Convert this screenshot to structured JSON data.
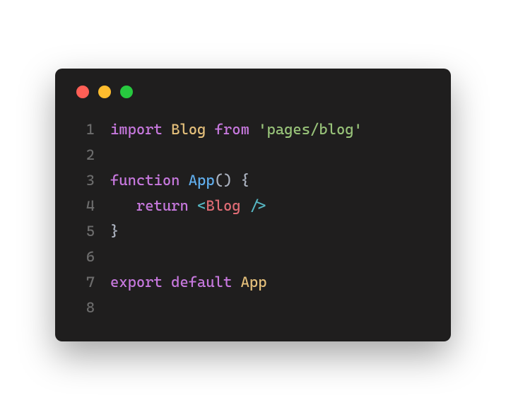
{
  "window": {
    "traffic_lights": [
      "red",
      "yellow",
      "green"
    ]
  },
  "code": {
    "lines": [
      {
        "num": "1",
        "tokens": [
          {
            "t": "import",
            "c": "tok-keyword"
          },
          {
            "t": " ",
            "c": ""
          },
          {
            "t": "Blog",
            "c": "tok-class"
          },
          {
            "t": " ",
            "c": ""
          },
          {
            "t": "from",
            "c": "tok-keyword"
          },
          {
            "t": " ",
            "c": ""
          },
          {
            "t": "'pages/blog'",
            "c": "tok-string"
          }
        ]
      },
      {
        "num": "2",
        "tokens": []
      },
      {
        "num": "3",
        "tokens": [
          {
            "t": "function",
            "c": "tok-keyword"
          },
          {
            "t": " ",
            "c": ""
          },
          {
            "t": "App",
            "c": "tok-func"
          },
          {
            "t": "()",
            "c": "tok-punct"
          },
          {
            "t": " ",
            "c": ""
          },
          {
            "t": "{",
            "c": "tok-punct"
          }
        ]
      },
      {
        "num": "4",
        "tokens": [
          {
            "t": "   ",
            "c": ""
          },
          {
            "t": "return",
            "c": "tok-keyword"
          },
          {
            "t": " ",
            "c": ""
          },
          {
            "t": "<",
            "c": "tok-tag"
          },
          {
            "t": "Blog",
            "c": "tok-tagname"
          },
          {
            "t": " ",
            "c": ""
          },
          {
            "t": "/>",
            "c": "tok-tag"
          }
        ]
      },
      {
        "num": "5",
        "tokens": [
          {
            "t": "}",
            "c": "tok-punct"
          }
        ]
      },
      {
        "num": "6",
        "tokens": []
      },
      {
        "num": "7",
        "tokens": [
          {
            "t": "export",
            "c": "tok-keyword"
          },
          {
            "t": " ",
            "c": ""
          },
          {
            "t": "default",
            "c": "tok-keyword"
          },
          {
            "t": " ",
            "c": ""
          },
          {
            "t": "App",
            "c": "tok-class"
          }
        ]
      },
      {
        "num": "8",
        "tokens": []
      }
    ]
  }
}
